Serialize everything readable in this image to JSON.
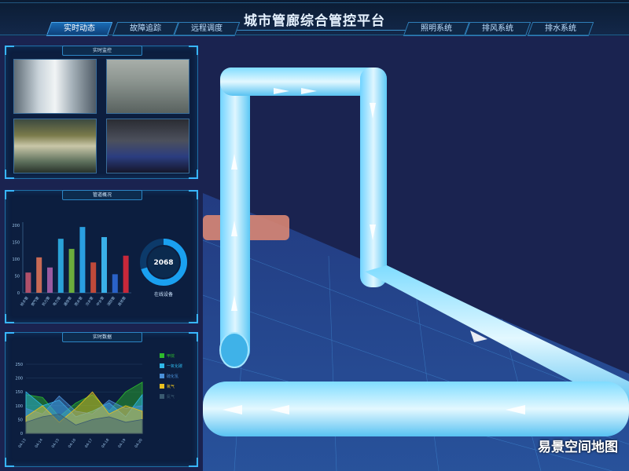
{
  "app": {
    "title": "城市管廊综合管控平台",
    "tabs": [
      {
        "label": "实时动态",
        "active": true
      },
      {
        "label": "故障追踪",
        "active": false
      },
      {
        "label": "远程调度",
        "active": false
      },
      {
        "label": "照明系统",
        "active": false
      },
      {
        "label": "排风系统",
        "active": false
      },
      {
        "label": "排水系统",
        "active": false
      }
    ]
  },
  "panels": {
    "video": {
      "title": "实时监控"
    },
    "bar": {
      "title": "管道概况"
    },
    "line": {
      "title": "实时数据"
    }
  },
  "gauge": {
    "value": "2068",
    "label": "在线设备",
    "fill_fraction": 0.7
  },
  "watermark": "易景空间地图",
  "chart_data": [
    {
      "type": "bar",
      "title": "",
      "categories": [
        "给水管",
        "燃气管",
        "热力管",
        "电力管",
        "通信管",
        "雨水管",
        "污水管",
        "中水管",
        "消防管",
        "其他管"
      ],
      "values": [
        60,
        105,
        75,
        160,
        130,
        195,
        90,
        165,
        55,
        110
      ],
      "colors": [
        "#b0506a",
        "#c86a55",
        "#9a5aa0",
        "#2aa3d8",
        "#6cae3c",
        "#2a9fe0",
        "#c04a3a",
        "#3ab0e8",
        "#2a62c8",
        "#c8283a"
      ],
      "ylim": [
        0,
        200
      ],
      "yticks": [
        0,
        50,
        100,
        150,
        200
      ],
      "ytick_labels": [
        "0",
        "50",
        "100",
        "150",
        "200"
      ]
    },
    {
      "type": "area",
      "title": "",
      "x": [
        "04-13",
        "04-14",
        "04-15",
        "04-16",
        "04-17",
        "04-18",
        "04-19",
        "04-20"
      ],
      "ylim": [
        0,
        250
      ],
      "yticks": [
        0,
        50,
        100,
        150,
        200,
        250
      ],
      "series": [
        {
          "name": "甲烷",
          "color": "#2dbb2d",
          "values": [
            140,
            130,
            60,
            110,
            140,
            80,
            150,
            185
          ]
        },
        {
          "name": "一氧化碳",
          "color": "#2fb7e8",
          "values": [
            150,
            100,
            120,
            60,
            80,
            110,
            60,
            140
          ]
        },
        {
          "name": "硫化氢",
          "color": "#4a90d8",
          "values": [
            90,
            70,
            135,
            80,
            70,
            120,
            90,
            100
          ]
        },
        {
          "name": "氧气",
          "color": "#e8c020",
          "values": [
            60,
            100,
            40,
            90,
            150,
            70,
            100,
            80
          ]
        },
        {
          "name": "氮气",
          "color": "#3a5a70",
          "values": [
            40,
            60,
            70,
            30,
            50,
            60,
            40,
            50
          ]
        }
      ]
    }
  ]
}
